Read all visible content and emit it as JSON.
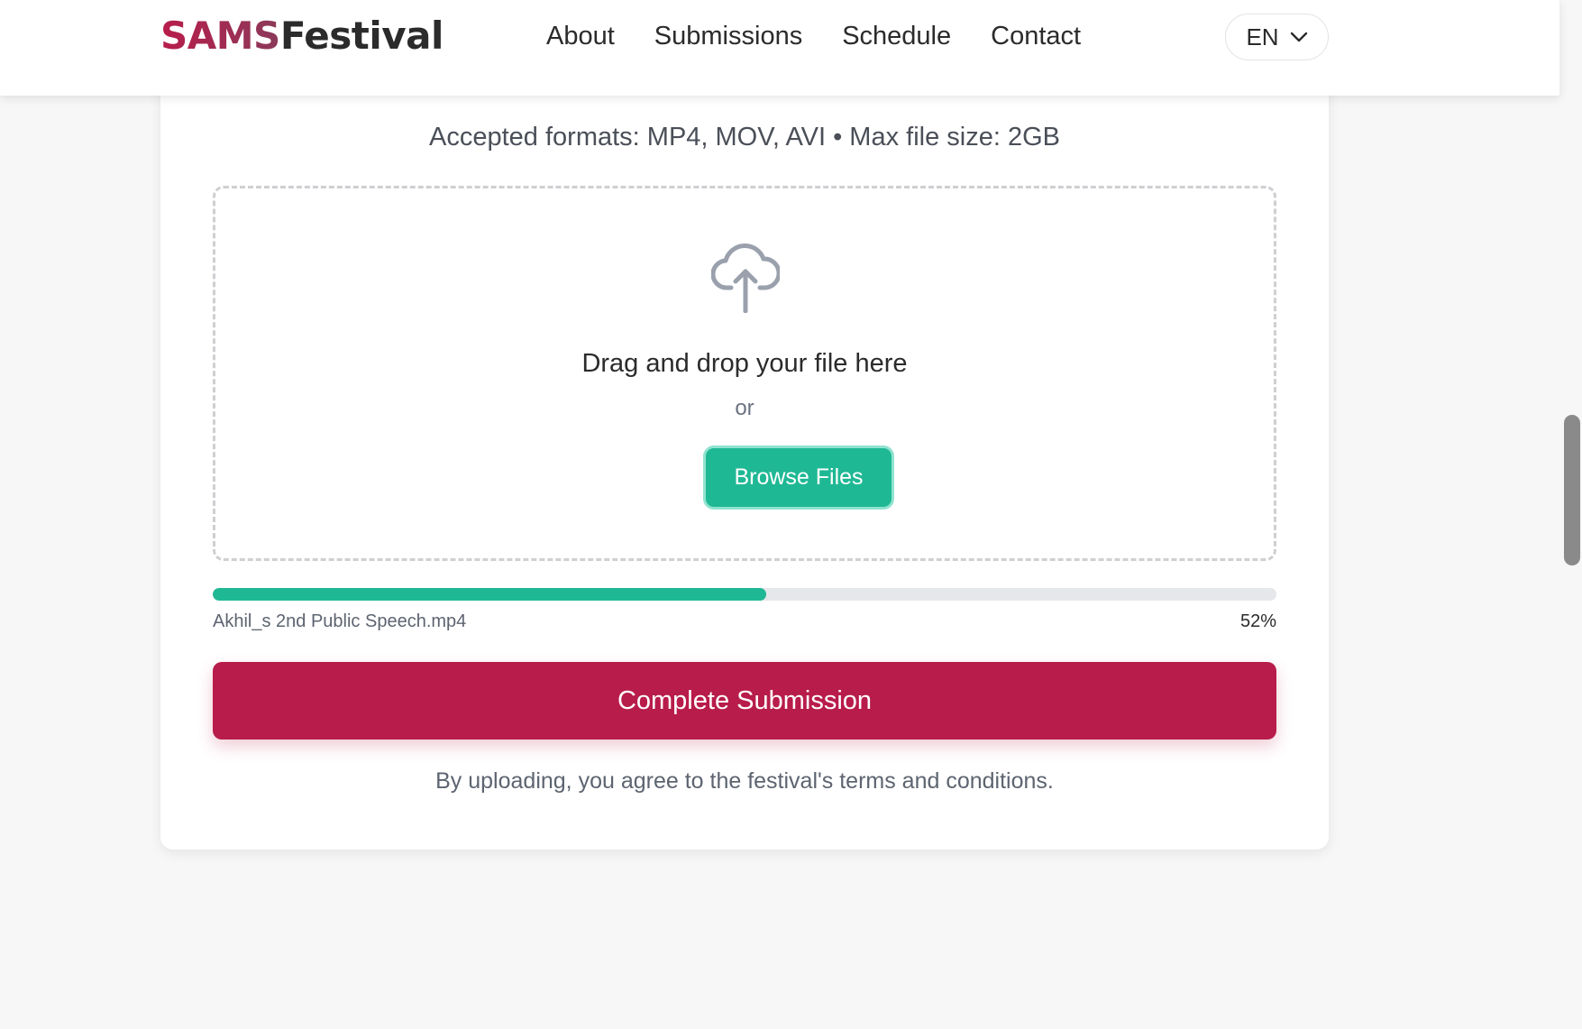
{
  "brand": {
    "part1": "SAMS",
    "part2": "Festival",
    "colors": {
      "accent": "#b81c4a",
      "accent_gradient_end": "#8b3a5a",
      "dark": "#2b2b2b"
    }
  },
  "nav": {
    "items": [
      {
        "label": "About"
      },
      {
        "label": "Submissions"
      },
      {
        "label": "Schedule"
      },
      {
        "label": "Contact"
      }
    ]
  },
  "language": {
    "selected": "EN",
    "icon": "chevron-down-icon"
  },
  "upload": {
    "formats_text": "Accepted formats: MP4, MOV, AVI • Max file size: 2GB",
    "dropzone": {
      "icon": "cloud-upload-icon",
      "title": "Drag and drop your file here",
      "or": "or",
      "browse_label": "Browse Files"
    },
    "progress": {
      "file_name": "Akhil_s 2nd Public Speech.mp4",
      "percent_label": "52%",
      "fraction": 0.52,
      "color": "#1fb894"
    },
    "submit_label": "Complete Submission",
    "terms_text": "By uploading, you agree to the festival's terms and conditions."
  },
  "colors": {
    "primary_green": "#1fb894",
    "submit_red": "#b81c4a",
    "page_bg": "#f7f7f7"
  }
}
